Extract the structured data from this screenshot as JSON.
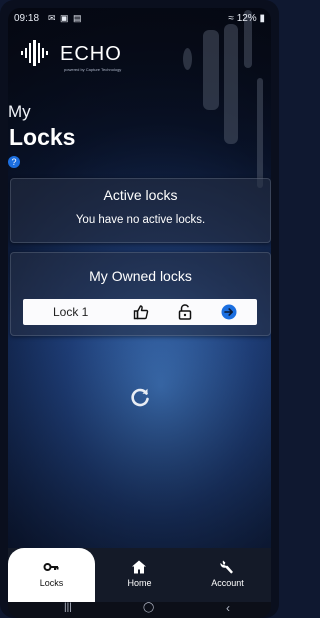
{
  "status_bar": {
    "time": "09:18",
    "icons": "✉ ▣ ▤",
    "battery": "12%"
  },
  "logo": {
    "word": "ECHO",
    "subtitle": "powered by Capture Technology"
  },
  "header": {
    "line1": "My",
    "line2": "Locks",
    "help_icon": "?"
  },
  "active_card": {
    "title": "Active locks",
    "message": "You have no active locks."
  },
  "owned_card": {
    "title": "My Owned locks",
    "locks": [
      {
        "name": "Lock 1"
      }
    ]
  },
  "tabs": [
    {
      "label": "Locks",
      "icon": "key-icon",
      "active": true
    },
    {
      "label": "Home",
      "icon": "home-icon",
      "active": false
    },
    {
      "label": "Account",
      "icon": "wrench-icon",
      "active": false
    }
  ],
  "navbar": {
    "recent": "|||",
    "home": "◯",
    "back": "‹"
  },
  "colors": {
    "accent": "#1c6fe0",
    "tab_bar": "#141a28"
  }
}
